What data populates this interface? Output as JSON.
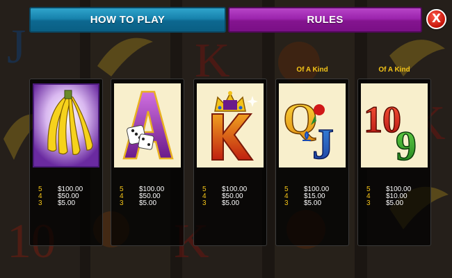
{
  "tabs": {
    "how_to_play": "HOW TO PLAY",
    "rules": "RULES",
    "close_glyph": "X"
  },
  "colors": {
    "how_to_play_tab": "#1782ac",
    "rules_tab": "#9b24ad",
    "close_button": "#d91a0c",
    "pay_count": "#f5c518",
    "pay_amount": "#ffffff"
  },
  "symbols": [
    {
      "symbol": "banana-bunch",
      "caption": "",
      "pays": [
        {
          "count": "5",
          "amount": "$100.00"
        },
        {
          "count": "4",
          "amount": "$50.00"
        },
        {
          "count": "3",
          "amount": "$5.00"
        }
      ]
    },
    {
      "symbol": "ace-with-dice",
      "caption": "",
      "pays": [
        {
          "count": "5",
          "amount": "$100.00"
        },
        {
          "count": "4",
          "amount": "$50.00"
        },
        {
          "count": "3",
          "amount": "$5.00"
        }
      ]
    },
    {
      "symbol": "king-with-crown",
      "caption": "",
      "pays": [
        {
          "count": "5",
          "amount": "$100.00"
        },
        {
          "count": "4",
          "amount": "$50.00"
        },
        {
          "count": "3",
          "amount": "$5.00"
        }
      ]
    },
    {
      "symbol": "queen-jack",
      "caption": "Of A Kind",
      "pays": [
        {
          "count": "5",
          "amount": "$100.00"
        },
        {
          "count": "4",
          "amount": "$15.00"
        },
        {
          "count": "3",
          "amount": "$5.00"
        }
      ]
    },
    {
      "symbol": "ten-nine",
      "caption": "Of A Kind",
      "pays": [
        {
          "count": "5",
          "amount": "$100.00"
        },
        {
          "count": "4",
          "amount": "$10.00"
        },
        {
          "count": "3",
          "amount": "$5.00"
        }
      ]
    }
  ]
}
